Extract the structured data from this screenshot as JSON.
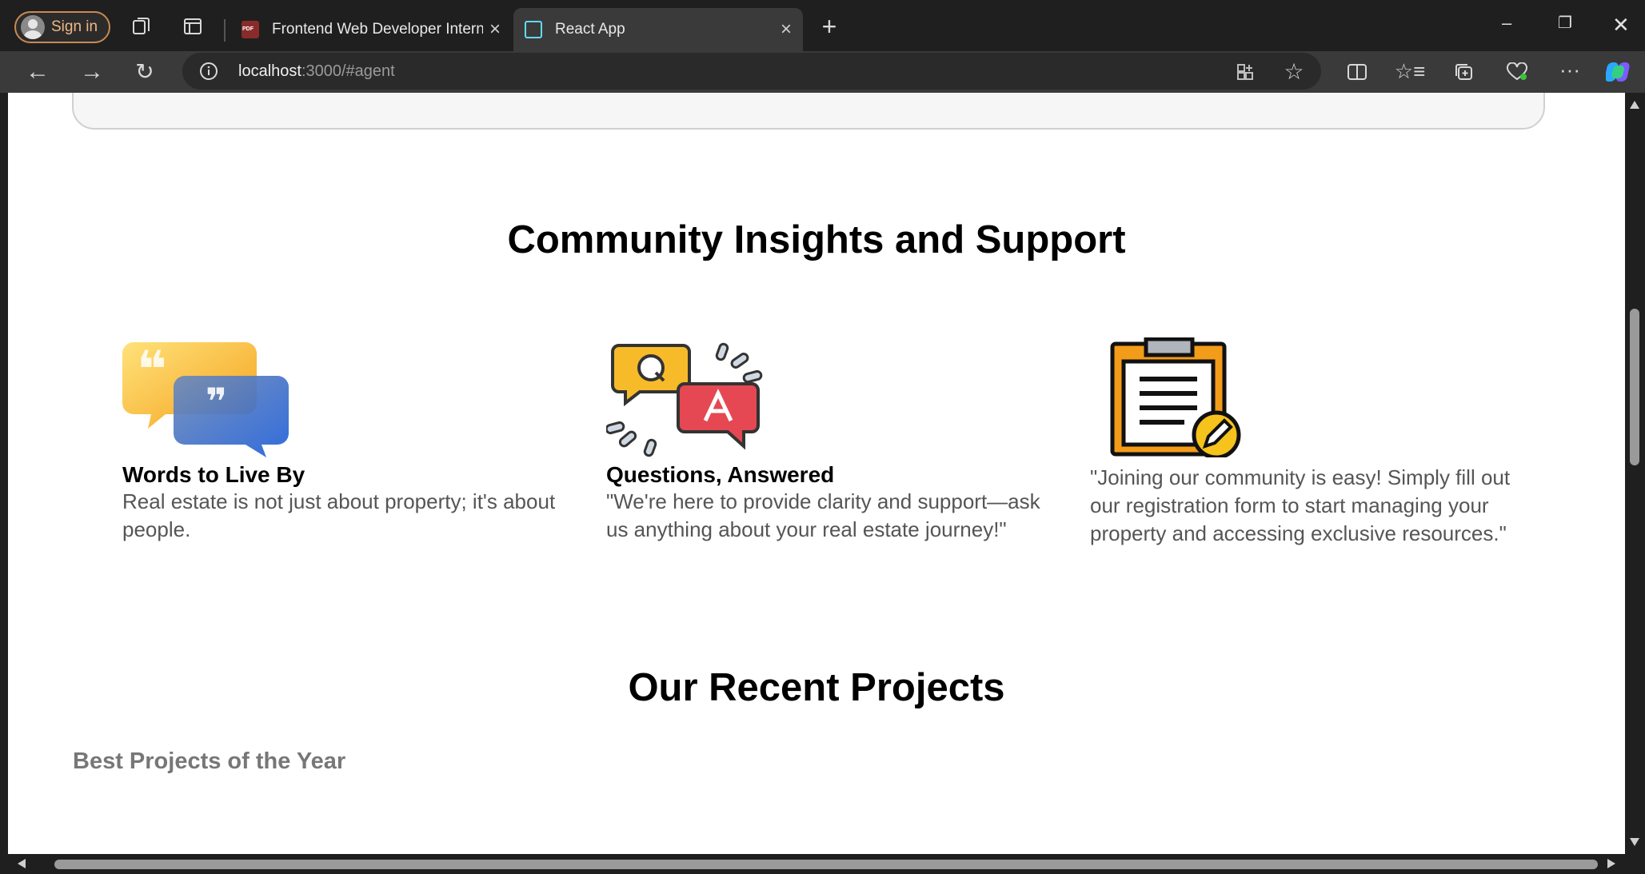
{
  "browser": {
    "profile_label": "Sign in",
    "tabs": [
      {
        "title": "Frontend Web Developer Internsh",
        "active": false
      },
      {
        "title": "React App",
        "active": true
      }
    ],
    "url_host": "localhost",
    "url_rest": ":3000/#agent"
  },
  "insights": {
    "title": "Community Insights and Support",
    "cards": [
      {
        "heading": "Words to Live By",
        "text": "Real estate is not just about property; it's about people.",
        "icon": "quote-bubbles-icon"
      },
      {
        "heading": "Questions, Answered",
        "text": "\"We're here to provide clarity and support—ask us anything about your real estate journey!\"",
        "icon": "qa-bubbles-icon"
      },
      {
        "heading": "",
        "text": "\"Joining our community is easy! Simply fill out our registration form to start managing your property and accessing exclusive resources.\"",
        "icon": "clipboard-edit-icon"
      }
    ]
  },
  "projects": {
    "title": "Our Recent Projects",
    "subtitle": "Best Projects of the Year"
  }
}
